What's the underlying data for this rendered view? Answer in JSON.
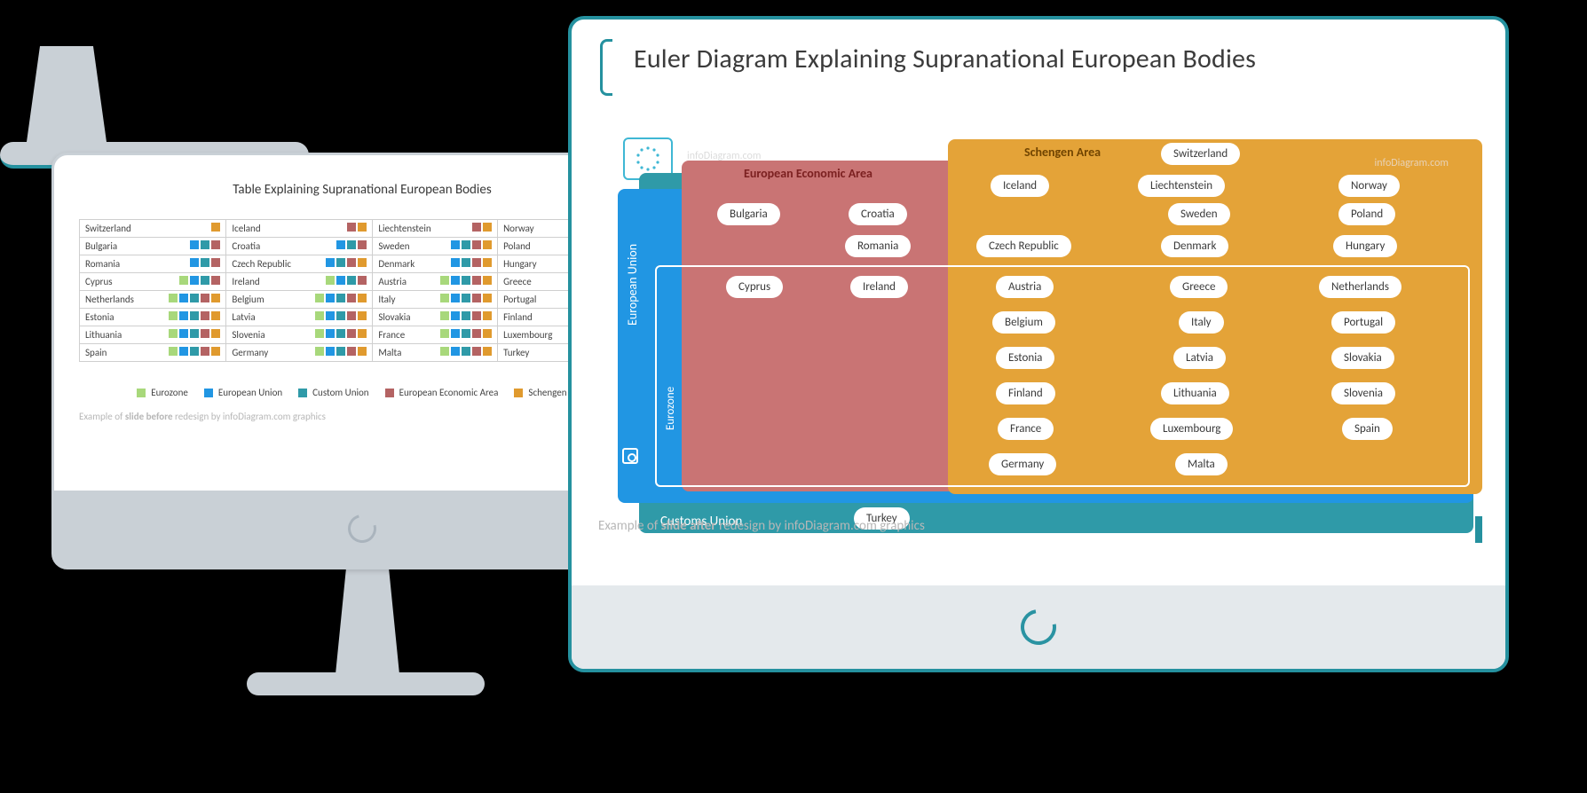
{
  "left": {
    "title": "Table Explaining Supranational European Bodies",
    "rows": [
      [
        {
          "n": "Switzerland",
          "m": [
            "sa"
          ]
        },
        {
          "n": "Iceland",
          "m": [
            "ea",
            "sa"
          ]
        },
        {
          "n": "Liechtenstein",
          "m": [
            "ea",
            "sa"
          ]
        },
        {
          "n": "Norway",
          "m": [
            "ea",
            "sa"
          ]
        }
      ],
      [
        {
          "n": "Bulgaria",
          "m": [
            "eu",
            "cu",
            "ea"
          ]
        },
        {
          "n": "Croatia",
          "m": [
            "eu",
            "cu",
            "ea"
          ]
        },
        {
          "n": "Sweden",
          "m": [
            "eu",
            "cu",
            "ea",
            "sa"
          ]
        },
        {
          "n": "Poland",
          "m": [
            "eu",
            "cu",
            "ea",
            "sa"
          ]
        }
      ],
      [
        {
          "n": "Romania",
          "m": [
            "eu",
            "cu",
            "ea"
          ]
        },
        {
          "n": "Czech Republic",
          "m": [
            "eu",
            "cu",
            "ea",
            "sa"
          ]
        },
        {
          "n": "Denmark",
          "m": [
            "eu",
            "cu",
            "ea",
            "sa"
          ]
        },
        {
          "n": "Hungary",
          "m": [
            "eu",
            "cu",
            "ea",
            "sa"
          ]
        }
      ],
      [
        {
          "n": "Cyprus",
          "m": [
            "ez",
            "eu",
            "cu",
            "ea"
          ]
        },
        {
          "n": "Ireland",
          "m": [
            "ez",
            "eu",
            "cu",
            "ea"
          ]
        },
        {
          "n": "Austria",
          "m": [
            "ez",
            "eu",
            "cu",
            "ea",
            "sa"
          ]
        },
        {
          "n": "Greece",
          "m": [
            "ez",
            "eu",
            "cu",
            "ea",
            "sa"
          ]
        }
      ],
      [
        {
          "n": "Netherlands",
          "m": [
            "ez",
            "eu",
            "cu",
            "ea",
            "sa"
          ]
        },
        {
          "n": "Belgium",
          "m": [
            "ez",
            "eu",
            "cu",
            "ea",
            "sa"
          ]
        },
        {
          "n": "Italy",
          "m": [
            "ez",
            "eu",
            "cu",
            "ea",
            "sa"
          ]
        },
        {
          "n": "Portugal",
          "m": [
            "ez",
            "eu",
            "cu",
            "ea",
            "sa"
          ]
        }
      ],
      [
        {
          "n": "Estonia",
          "m": [
            "ez",
            "eu",
            "cu",
            "ea",
            "sa"
          ]
        },
        {
          "n": "Latvia",
          "m": [
            "ez",
            "eu",
            "cu",
            "ea",
            "sa"
          ]
        },
        {
          "n": "Slovakia",
          "m": [
            "ez",
            "eu",
            "cu",
            "ea",
            "sa"
          ]
        },
        {
          "n": "Finland",
          "m": [
            "ez",
            "eu",
            "cu",
            "ea",
            "sa"
          ]
        }
      ],
      [
        {
          "n": "Lithuania",
          "m": [
            "ez",
            "eu",
            "cu",
            "ea",
            "sa"
          ]
        },
        {
          "n": "Slovenia",
          "m": [
            "ez",
            "eu",
            "cu",
            "ea",
            "sa"
          ]
        },
        {
          "n": "France",
          "m": [
            "ez",
            "eu",
            "cu",
            "ea",
            "sa"
          ]
        },
        {
          "n": "Luxembourg",
          "m": [
            "ez",
            "eu",
            "cu",
            "ea",
            "sa"
          ]
        }
      ],
      [
        {
          "n": "Spain",
          "m": [
            "ez",
            "eu",
            "cu",
            "ea",
            "sa"
          ]
        },
        {
          "n": "Germany",
          "m": [
            "ez",
            "eu",
            "cu",
            "ea",
            "sa"
          ]
        },
        {
          "n": "Malta",
          "m": [
            "ez",
            "eu",
            "cu",
            "ea",
            "sa"
          ]
        },
        {
          "n": "Turkey",
          "m": [
            "cu"
          ]
        }
      ]
    ],
    "legend": [
      {
        "c": "ez",
        "l": "Eurozone"
      },
      {
        "c": "eu",
        "l": "European Union"
      },
      {
        "c": "cu",
        "l": "Custom Union"
      },
      {
        "c": "ea",
        "l": "European Economic Area"
      },
      {
        "c": "sa",
        "l": "Schengen Area"
      }
    ],
    "caption_a": "Example of ",
    "caption_b": "slide before",
    "caption_c": " redesign by infoDiagram.com graphics"
  },
  "right": {
    "title": "Euler Diagram Explaining Supranational European Bodies",
    "labels": {
      "schengen": "Schengen Area",
      "eea": "European Economic Area",
      "eu": "European Union",
      "ez": "Eurozone",
      "cu": "Customs Union"
    },
    "watermark": "infoDiagram.com",
    "pills": {
      "switzerland": "Switzerland",
      "iceland": "Iceland",
      "liechtenstein": "Liechtenstein",
      "norway": "Norway",
      "bulgaria": "Bulgaria",
      "croatia": "Croatia",
      "romania": "Romania",
      "sweden": "Sweden",
      "poland": "Poland",
      "czech": "Czech Republic",
      "denmark": "Denmark",
      "hungary": "Hungary",
      "cyprus": "Cyprus",
      "ireland": "Ireland",
      "austria": "Austria",
      "greece": "Greece",
      "netherlands": "Netherlands",
      "belgium": "Belgium",
      "italy": "Italy",
      "portugal": "Portugal",
      "estonia": "Estonia",
      "latvia": "Latvia",
      "slovakia": "Slovakia",
      "finland": "Finland",
      "lithuania": "Lithuania",
      "slovenia": "Slovenia",
      "france": "France",
      "luxembourg": "Luxembourg",
      "spain": "Spain",
      "germany": "Germany",
      "malta": "Malta",
      "turkey": "Turkey"
    },
    "caption_a": "Example of ",
    "caption_b": "slide after",
    "caption_c": " redesign by infoDiagram.com graphics"
  },
  "colors": {
    "ez": "#a8d87b",
    "eu": "#2196e3",
    "cu": "#2f9aa8",
    "ea": "#b46363",
    "sa": "#e09a2e"
  },
  "chart_data": {
    "type": "euler-diagram",
    "sets": {
      "Schengen Area": [
        "Switzerland",
        "Iceland",
        "Liechtenstein",
        "Norway",
        "Sweden",
        "Poland",
        "Czech Republic",
        "Denmark",
        "Hungary",
        "Austria",
        "Greece",
        "Netherlands",
        "Belgium",
        "Italy",
        "Portugal",
        "Estonia",
        "Latvia",
        "Slovakia",
        "Finland",
        "Lithuania",
        "Slovenia",
        "France",
        "Luxembourg",
        "Spain",
        "Germany",
        "Malta"
      ],
      "European Economic Area": [
        "Iceland",
        "Liechtenstein",
        "Norway",
        "Bulgaria",
        "Croatia",
        "Romania",
        "Sweden",
        "Poland",
        "Czech Republic",
        "Denmark",
        "Hungary",
        "Cyprus",
        "Ireland",
        "Austria",
        "Greece",
        "Netherlands",
        "Belgium",
        "Italy",
        "Portugal",
        "Estonia",
        "Latvia",
        "Slovakia",
        "Finland",
        "Lithuania",
        "Slovenia",
        "France",
        "Luxembourg",
        "Spain",
        "Germany",
        "Malta"
      ],
      "European Union": [
        "Bulgaria",
        "Croatia",
        "Romania",
        "Sweden",
        "Poland",
        "Czech Republic",
        "Denmark",
        "Hungary",
        "Cyprus",
        "Ireland",
        "Austria",
        "Greece",
        "Netherlands",
        "Belgium",
        "Italy",
        "Portugal",
        "Estonia",
        "Latvia",
        "Slovakia",
        "Finland",
        "Lithuania",
        "Slovenia",
        "France",
        "Luxembourg",
        "Spain",
        "Germany",
        "Malta"
      ],
      "Customs Union": [
        "Turkey",
        "Bulgaria",
        "Croatia",
        "Romania",
        "Sweden",
        "Poland",
        "Czech Republic",
        "Denmark",
        "Hungary",
        "Cyprus",
        "Ireland",
        "Austria",
        "Greece",
        "Netherlands",
        "Belgium",
        "Italy",
        "Portugal",
        "Estonia",
        "Latvia",
        "Slovakia",
        "Finland",
        "Lithuania",
        "Slovenia",
        "France",
        "Luxembourg",
        "Spain",
        "Germany",
        "Malta"
      ],
      "Eurozone": [
        "Cyprus",
        "Ireland",
        "Austria",
        "Greece",
        "Netherlands",
        "Belgium",
        "Italy",
        "Portugal",
        "Estonia",
        "Latvia",
        "Slovakia",
        "Finland",
        "Lithuania",
        "Slovenia",
        "France",
        "Luxembourg",
        "Spain",
        "Germany",
        "Malta"
      ]
    }
  }
}
